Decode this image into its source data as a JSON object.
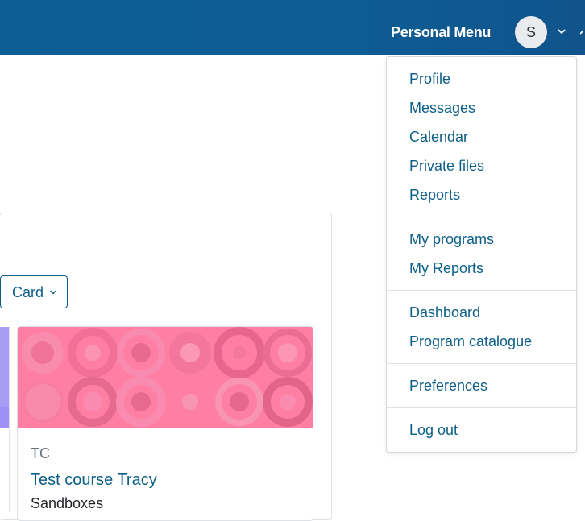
{
  "header": {
    "menu_title": "Personal Menu",
    "avatar_initial": "S"
  },
  "block": {
    "view_select": {
      "selected": "Card"
    }
  },
  "course": {
    "shortname": "TC",
    "name": "Test course Tracy",
    "category": "Sandboxes",
    "image_color": "#fe7fa3"
  },
  "menu": {
    "group1": [
      "Profile",
      "Messages",
      "Calendar",
      "Private files",
      "Reports"
    ],
    "group2": [
      "My programs",
      "My Reports"
    ],
    "group3": [
      "Dashboard",
      "Program catalogue"
    ],
    "group4": [
      "Preferences"
    ],
    "group5": [
      "Log out"
    ]
  },
  "colors": {
    "brand": "#0b5e88",
    "navbar": "#0e5c94",
    "link": "#0b5e88"
  }
}
